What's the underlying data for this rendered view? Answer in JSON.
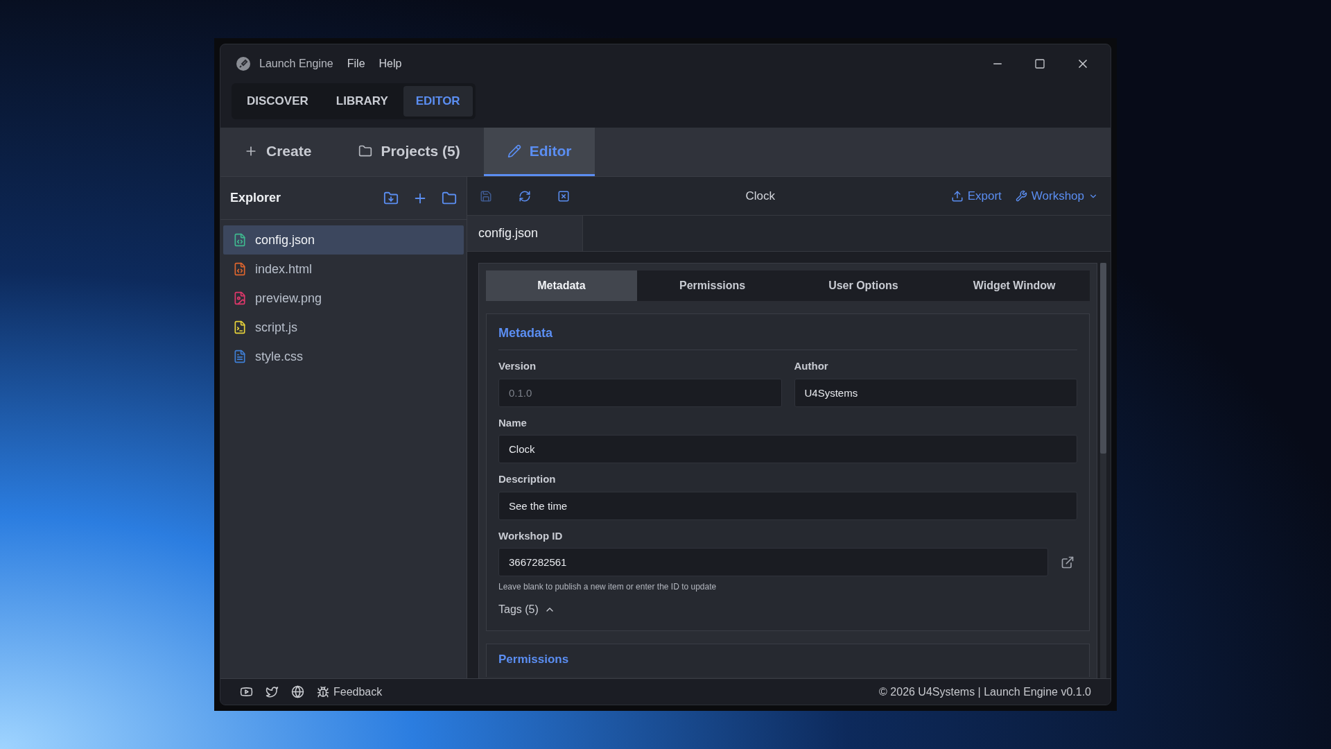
{
  "window": {
    "title": "Launch Engine",
    "menu": [
      "File",
      "Help"
    ]
  },
  "main_tabs": [
    {
      "label": "DISCOVER",
      "selected": false
    },
    {
      "label": "LIBRARY",
      "selected": false
    },
    {
      "label": "EDITOR",
      "selected": true
    }
  ],
  "section_tabs": [
    {
      "label": "Create",
      "kind": "create",
      "selected": false
    },
    {
      "label": "Projects (5)",
      "kind": "projects",
      "selected": false
    },
    {
      "label": "Editor",
      "kind": "editor",
      "selected": true
    }
  ],
  "explorer": {
    "title": "Explorer",
    "files": [
      {
        "name": "config.json",
        "kind": "json",
        "color": "#3fb98f",
        "selected": true
      },
      {
        "name": "index.html",
        "kind": "html",
        "color": "#e0662e",
        "selected": false
      },
      {
        "name": "preview.png",
        "kind": "image",
        "color": "#e0386b",
        "selected": false
      },
      {
        "name": "script.js",
        "kind": "script",
        "color": "#e8d33a",
        "selected": false
      },
      {
        "name": "style.css",
        "kind": "text",
        "color": "#3f7fd6",
        "selected": false
      }
    ]
  },
  "toolbar": {
    "title": "Clock",
    "actions": [
      "Export",
      "Workshop"
    ]
  },
  "open_files": [
    {
      "name": "config.json",
      "selected": true
    }
  ],
  "config_tabs": [
    {
      "label": "Metadata",
      "selected": true
    },
    {
      "label": "Permissions",
      "selected": false
    },
    {
      "label": "User Options",
      "selected": false
    },
    {
      "label": "Widget Window",
      "selected": false
    }
  ],
  "metadata": {
    "heading": "Metadata",
    "version": {
      "label": "Version",
      "value": "0.1.0",
      "disabled": true
    },
    "author": {
      "label": "Author",
      "value": "U4Systems"
    },
    "name": {
      "label": "Name",
      "value": "Clock"
    },
    "description": {
      "label": "Description",
      "value": "See the time"
    },
    "workshop_id": {
      "label": "Workshop ID",
      "value": "3667282561",
      "hint": "Leave blank to publish a new item or enter the ID to update"
    },
    "tags": {
      "label": "Tags (5)",
      "expanded": true
    }
  },
  "next_section": {
    "heading": "Permissions"
  },
  "status_bar": {
    "feedback": "Feedback",
    "copyright": "© 2026 U4Systems | Launch Engine v0.1.0"
  }
}
